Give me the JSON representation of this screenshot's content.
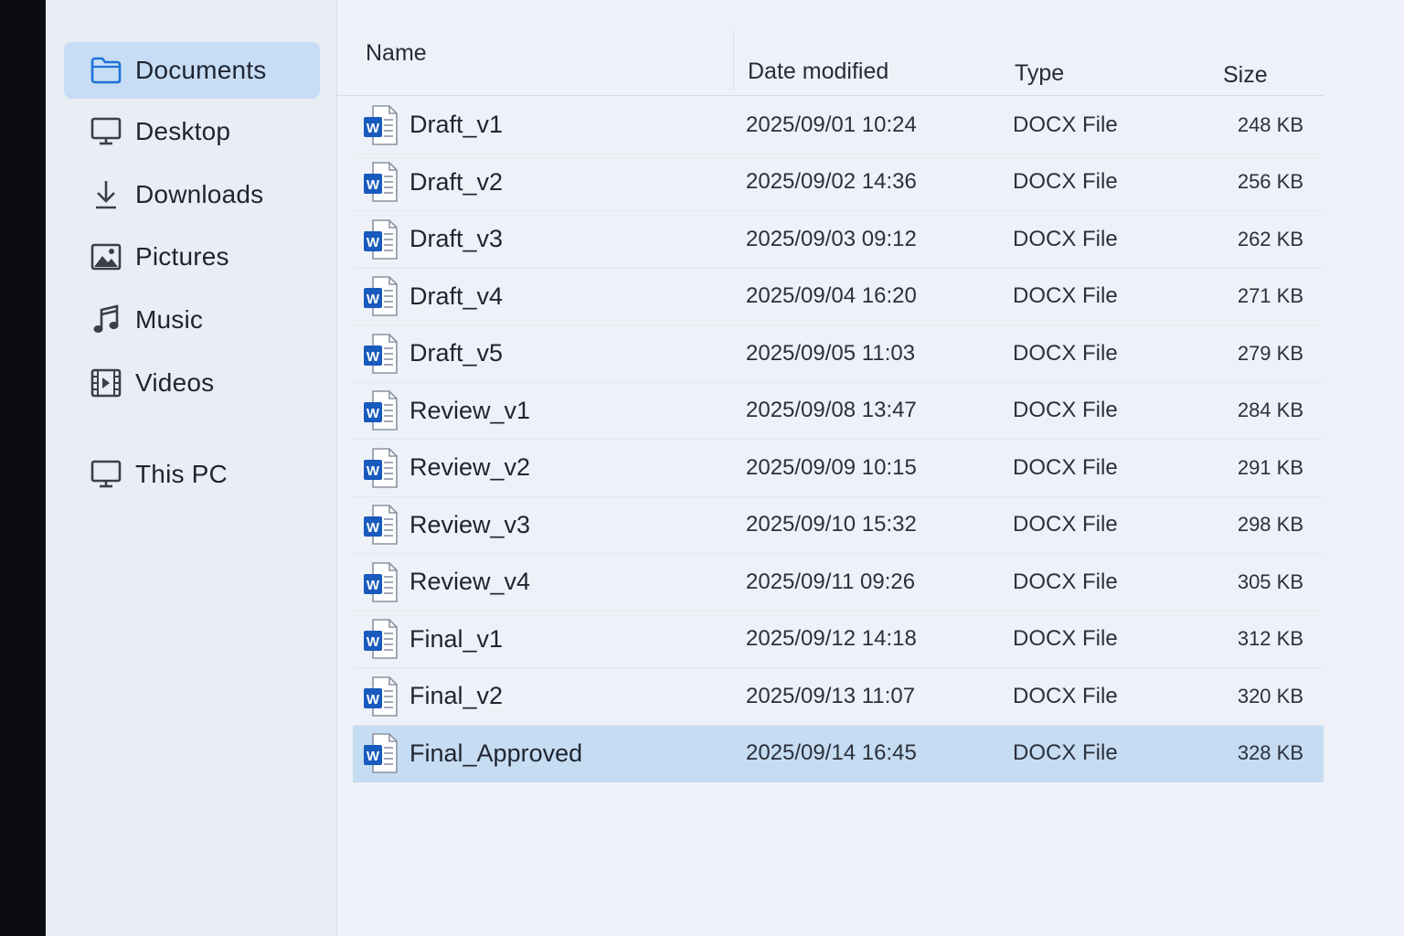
{
  "sidebar": {
    "items": [
      {
        "label": "Documents",
        "icon": "folder-icon",
        "selected": true
      },
      {
        "label": "Desktop",
        "icon": "desktop-icon"
      },
      {
        "label": "Downloads",
        "icon": "download-icon"
      },
      {
        "label": "Pictures",
        "icon": "pictures-icon"
      },
      {
        "label": "Music",
        "icon": "music-icon"
      },
      {
        "label": "Videos",
        "icon": "videos-icon"
      },
      {
        "label": "This PC",
        "icon": "this-pc-icon"
      }
    ]
  },
  "file_list": {
    "columns": {
      "name": "Name",
      "date_modified": "Date modified",
      "type": "Type",
      "size": "Size"
    },
    "rows": [
      {
        "name": "Draft_v1",
        "date": "2025/09/01 10:24",
        "type": "DOCX File",
        "size": "248 KB"
      },
      {
        "name": "Draft_v2",
        "date": "2025/09/02 14:36",
        "type": "DOCX File",
        "size": "256 KB"
      },
      {
        "name": "Draft_v3",
        "date": "2025/09/03 09:12",
        "type": "DOCX File",
        "size": "262 KB"
      },
      {
        "name": "Draft_v4",
        "date": "2025/09/04 16:20",
        "type": "DOCX File",
        "size": "271 KB"
      },
      {
        "name": "Draft_v5",
        "date": "2025/09/05 11:03",
        "type": "DOCX File",
        "size": "279 KB"
      },
      {
        "name": "Review_v1",
        "date": "2025/09/08 13:47",
        "type": "DOCX File",
        "size": "284 KB"
      },
      {
        "name": "Review_v2",
        "date": "2025/09/09 10:15",
        "type": "DOCX File",
        "size": "291 KB"
      },
      {
        "name": "Review_v3",
        "date": "2025/09/10 15:32",
        "type": "DOCX File",
        "size": "298 KB"
      },
      {
        "name": "Review_v4",
        "date": "2025/09/11 09:26",
        "type": "DOCX File",
        "size": "305 KB"
      },
      {
        "name": "Final_v1",
        "date": "2025/09/12 14:18",
        "type": "DOCX File",
        "size": "312 KB"
      },
      {
        "name": "Final_v2",
        "date": "2025/09/13 11:07",
        "type": "DOCX File",
        "size": "320 KB"
      },
      {
        "name": "Final_Approved",
        "date": "2025/09/14 16:45",
        "type": "DOCX File",
        "size": "328 KB",
        "selected": true
      }
    ]
  },
  "colors": {
    "accent_blue": "#185abd",
    "selection": "#c6dcf2",
    "folder_blue": "#1e73d8"
  }
}
